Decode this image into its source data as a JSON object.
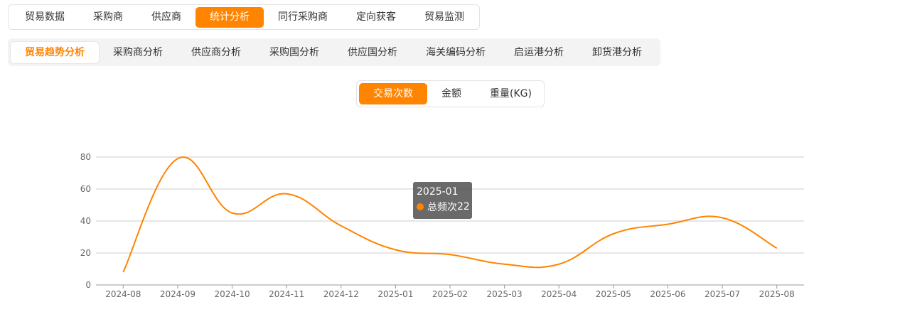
{
  "top_tabs": [
    "贸易数据",
    "采购商",
    "供应商",
    "统计分析",
    "同行采购商",
    "定向获客",
    "贸易监测"
  ],
  "top_active": 3,
  "sub_tabs": [
    "贸易趋势分析",
    "采购商分析",
    "供应商分析",
    "采购国分析",
    "供应国分析",
    "海关编码分析",
    "启运港分析",
    "卸货港分析"
  ],
  "sub_active": 0,
  "metric_tabs": [
    "交易次数",
    "金额",
    "重量(KG)"
  ],
  "metric_active": 0,
  "colors": {
    "accent": "#ff8400",
    "grid": "#cccccc",
    "axis": "#999999"
  },
  "tooltip": {
    "title": "2025-01",
    "series_name": "总频次",
    "value": "22"
  },
  "chart_data": {
    "type": "line",
    "smooth": true,
    "categories": [
      "2024-08",
      "2024-09",
      "2024-10",
      "2024-11",
      "2024-12",
      "2025-01",
      "2025-02",
      "2025-03",
      "2025-04",
      "2025-05",
      "2025-06",
      "2025-07",
      "2025-08"
    ],
    "series": [
      {
        "values": [
          8,
          79,
          45,
          57,
          37,
          22,
          19,
          13,
          13,
          32,
          38,
          42,
          23
        ]
      }
    ],
    "y_ticks": [
      0,
      20,
      40,
      60,
      80
    ],
    "ylim": [
      0,
      80
    ],
    "grid": true,
    "legend": "none"
  }
}
